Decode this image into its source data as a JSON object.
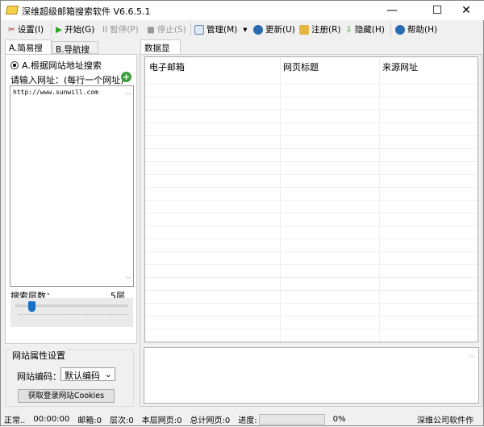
{
  "window": {
    "title": "深维超级邮箱搜索软件 V6.6.5.1"
  },
  "toolbar": {
    "settings": "设置(I)",
    "start": "开始(G)",
    "pause": "暂停(P)",
    "stop": "停止(S)",
    "manage": "管理(M)",
    "update": "更新(U)",
    "register": "注册(R)",
    "hide": "隐藏(H)",
    "help": "帮助(H)"
  },
  "left": {
    "tabs": [
      "A.简易搜索",
      "B.导航搜索"
    ],
    "radio_label": "A.根据网站地址搜索",
    "url_prompt": "请输入网址：(每行一个网址)",
    "url_value": "http://www.sunwill.com",
    "depth_label": "搜索层数：",
    "depth_value": "5层",
    "depth_level": 5,
    "group_title": "网站属性设置",
    "encoding_label": "网站编码：",
    "encoding_value": "默认编码",
    "cookies_button": "获取登录网站Cookies"
  },
  "right": {
    "tab": "数据显示",
    "columns": [
      "电子邮箱",
      "网页标题",
      "来源网址"
    ]
  },
  "status": {
    "state": "正常..",
    "time": "00:00:00",
    "emails": "邮箱:0",
    "level": "层次:0",
    "page_level": "本层网页:0",
    "total": "总计网页:0",
    "progress_label": "进度:",
    "progress": "0%",
    "company": "深维公司软件作"
  }
}
